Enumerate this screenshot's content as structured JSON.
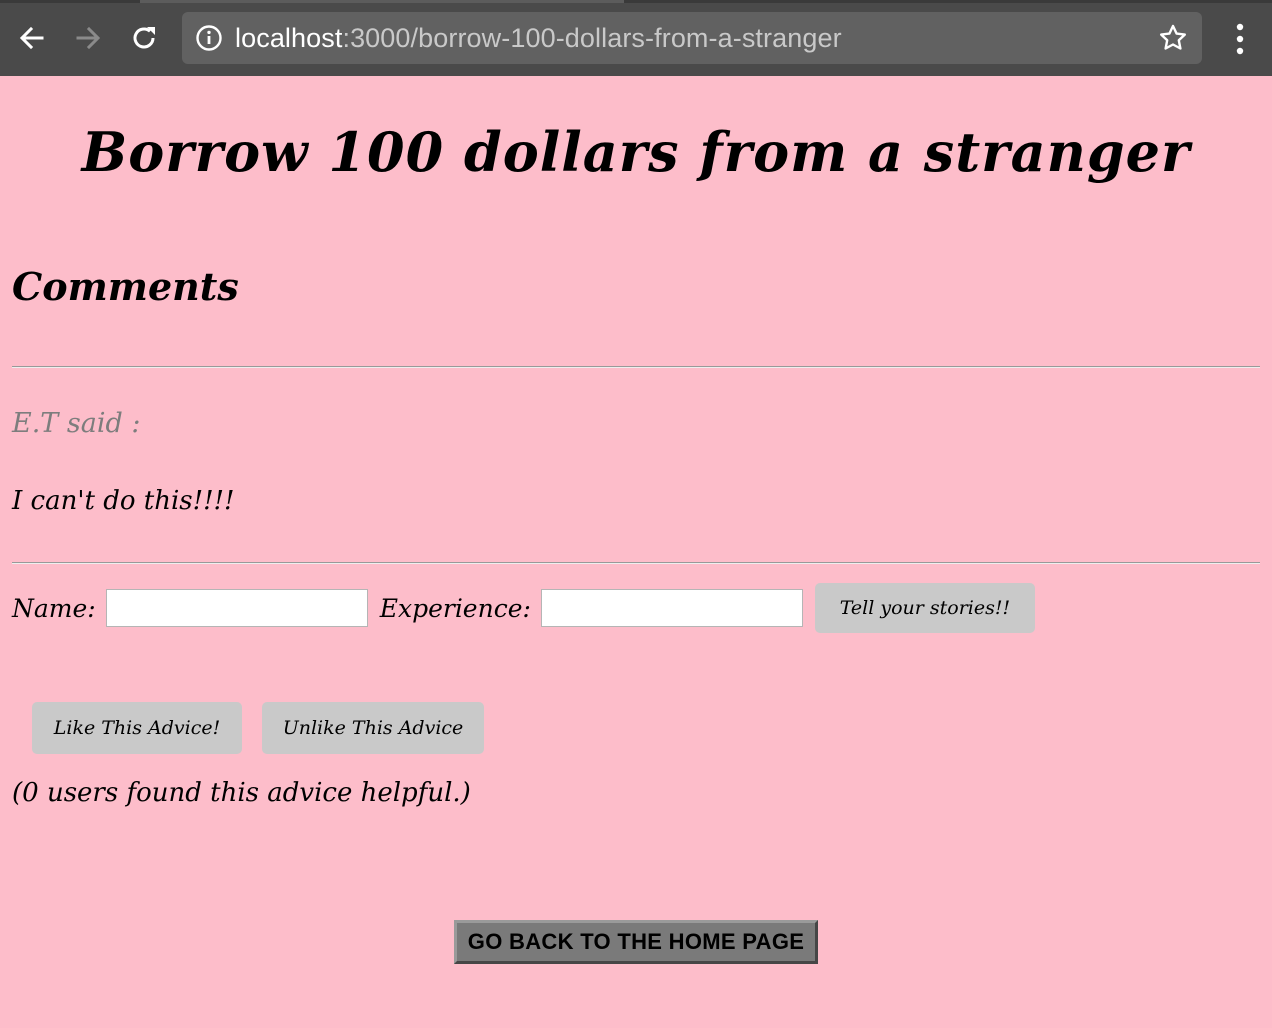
{
  "browser": {
    "url_host": "localhost",
    "url_rest": ":3000/borrow-100-dollars-from-a-stranger"
  },
  "page": {
    "title": "Borrow 100 dollars from a stranger",
    "comments_heading": "Comments"
  },
  "comments": [
    {
      "author": "E.T said :",
      "text": "I can't do this!!!!"
    }
  ],
  "form": {
    "name_label": "Name:",
    "name_value": "",
    "experience_label": "Experience:",
    "experience_value": "",
    "submit_label": "Tell your stories!!"
  },
  "votes": {
    "like_label": "Like This Advice!",
    "unlike_label": "Unlike This Advice",
    "helpful_text": "(0 users found this advice helpful.)"
  },
  "footer": {
    "home_button_label": "GO BACK TO THE HOME PAGE"
  },
  "colors": {
    "page_background": "#fdbdca",
    "chrome_background": "#4a4a4a",
    "button_gray": "#c9c9c9",
    "author_gray": "#7d7d7d"
  }
}
